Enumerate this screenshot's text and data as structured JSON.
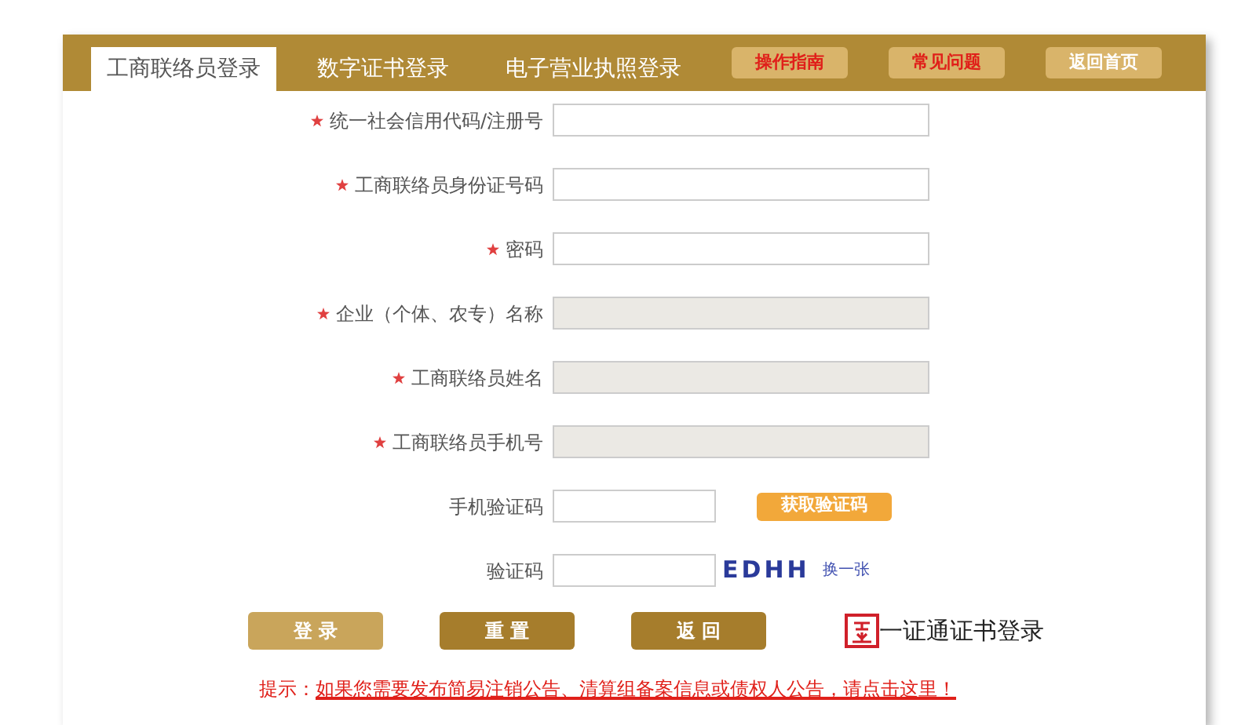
{
  "tabs": [
    {
      "label": "工商联络员登录",
      "selected": true
    },
    {
      "label": "数字证书登录",
      "selected": false
    },
    {
      "label": "电子营业执照登录",
      "selected": false
    }
  ],
  "header_buttons": [
    {
      "label": "操作指南",
      "kind": "alert"
    },
    {
      "label": "常见问题",
      "kind": "alert"
    },
    {
      "label": "返回首页",
      "kind": "plain"
    }
  ],
  "fields": [
    {
      "label": "统一社会信用代码/注册号",
      "required": true,
      "disabled": false,
      "kind": "plain"
    },
    {
      "label": "工商联络员身份证号码",
      "required": true,
      "disabled": false,
      "kind": "plain"
    },
    {
      "label": "密码",
      "required": true,
      "disabled": false,
      "kind": "plain"
    },
    {
      "label": "企业（个体、农专）名称",
      "required": true,
      "disabled": true,
      "kind": "plain"
    },
    {
      "label": "工商联络员姓名",
      "required": true,
      "disabled": true,
      "kind": "plain"
    },
    {
      "label": "工商联络员手机号",
      "required": true,
      "disabled": true,
      "kind": "plain"
    },
    {
      "label": "手机验证码",
      "required": false,
      "disabled": false,
      "kind": "sms",
      "action": "获取验证码"
    },
    {
      "label": "验证码",
      "required": false,
      "disabled": false,
      "kind": "captcha",
      "code": "EDHH",
      "refresh": "换一张"
    }
  ],
  "buttons": [
    {
      "label": "登 录",
      "color": "#c9a55b"
    },
    {
      "label": "重 置",
      "color": "#a67d2c"
    },
    {
      "label": "返 回",
      "color": "#a67d2c"
    }
  ],
  "cert_login": "一证通证书登录",
  "hint": {
    "prefix": "提示：",
    "link": "如果您需要发布简易注销公告、清算组备案信息或债权人公告，请点击这里！"
  }
}
